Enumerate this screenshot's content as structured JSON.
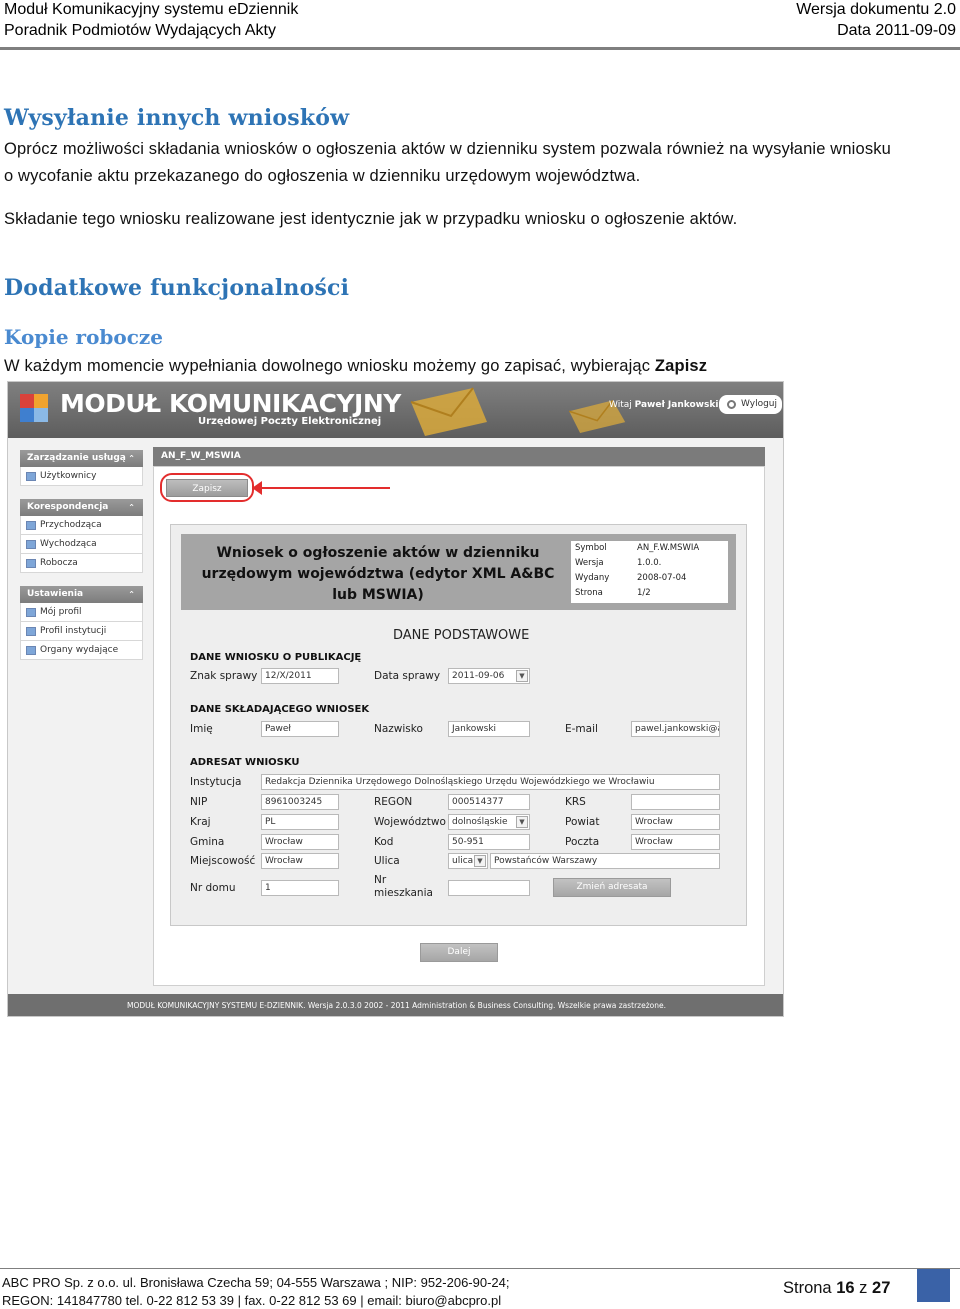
{
  "header": {
    "left_line1": "Moduł Komunikacyjny systemu eDziennik",
    "left_line2": "Poradnik Podmiotów Wydających Akty",
    "right_line1": "Wersja dokumentu 2.0",
    "right_line2": "Data 2011-09-09"
  },
  "section1": {
    "title": "Wysyłanie innych wniosków",
    "para1_line1": "Oprócz możliwości składania wniosków o ogłoszenia aktów w dzienniku system pozwala również na wysyłanie wniosku",
    "para1_line2": "o wycofanie aktu przekazanego do ogłoszenia w dzienniku urzędowym województwa.",
    "para2": "Składanie tego wniosku realizowane jest identycznie jak w przypadku wniosku o ogłoszenie aktów."
  },
  "section2": {
    "title": "Dodatkowe funkcjonalności",
    "subtitle": "Kopie robocze",
    "para_prefix": "W każdym momencie wypełniania dowolnego wniosku możemy go zapisać, wybierając ",
    "para_bold": "Zapisz"
  },
  "screenshot": {
    "brand": "MODUŁ KOMUNIKACYJNY",
    "brand_sub": "Urzędowej Poczty Elektronicznej",
    "welcome_prefix": "Witaj ",
    "welcome_user": "Paweł Jankowski",
    "logout": "Wyloguj",
    "sidebar": {
      "group1": "Zarządzanie usługą",
      "group1_items": [
        "Użytkownicy"
      ],
      "group2": "Korespondencja",
      "group2_items": [
        "Przychodząca",
        "Wychodząca",
        "Robocza"
      ],
      "group3": "Ustawienia",
      "group3_items": [
        "Mój profil",
        "Profil instytucji",
        "Organy wydające"
      ]
    },
    "main_title": "AN_F_W_MSWIA",
    "save_button": "Zapisz",
    "form_title": "Wniosek o ogłoszenie aktów w dzienniku urzędowym województwa (edytor XML A&BC lub MSWIA)",
    "meta": {
      "symbol_label": "Symbol",
      "symbol_value": "AN_F.W.MSWIA",
      "version_label": "Wersja",
      "version_value": "1.0.0.",
      "issued_label": "Wydany",
      "issued_value": "2008-07-04",
      "page_label": "Strona",
      "page_value": "1/2"
    },
    "section_title": "DANE PODSTAWOWE",
    "pub": {
      "group": "DANE WNIOSKU O PUBLIKACJĘ",
      "case_label": "Znak sprawy",
      "case_value": "12/X/2011",
      "date_label": "Data sprawy",
      "date_value": "2011-09-06"
    },
    "applicant": {
      "group": "DANE SKŁADAJĄCEGO WNIOSEK",
      "first_label": "Imię",
      "first_value": "Paweł",
      "last_label": "Nazwisko",
      "last_value": "Jankowski",
      "email_label": "E-mail",
      "email_value": "pawel.jankowski@a"
    },
    "addressee": {
      "group": "ADRESAT WNIOSKU",
      "inst_label": "Instytucja",
      "inst_value": "Redakcja Dziennika Urzędowego Dolnośląskiego Urzędu Wojewódzkiego we Wrocławiu",
      "nip_label": "NIP",
      "nip_value": "8961003245",
      "regon_label": "REGON",
      "regon_value": "000514377",
      "krs_label": "KRS",
      "krs_value": "",
      "country_label": "Kraj",
      "country_value": "PL",
      "voiv_label": "Województwo",
      "voiv_value": "dolnośląskie",
      "county_label": "Powiat",
      "county_value": "Wrocław",
      "commune_label": "Gmina",
      "commune_value": "Wrocław",
      "zip_label": "Kod",
      "zip_value": "50-951",
      "post_label": "Poczta",
      "post_value": "Wrocław",
      "city_label": "Miejscowość",
      "city_value": "Wrocław",
      "street_label": "Ulica",
      "street_type": "ulica",
      "street_value": "Powstańców Warszawy",
      "house_label": "Nr domu",
      "house_value": "1",
      "flat_label_1": "Nr",
      "flat_label_2": "mieszkania",
      "flat_value": "",
      "change_button": "Zmień adresata"
    },
    "next_button": "Dalej",
    "footer": "MODUŁ KOMUNIKACYJNY SYSTEMU E-DZIENNIK. Wersja 2.0.3.0 2002 - 2011 Administration & Business Consulting. Wszelkie prawa zastrzeżone."
  },
  "footer": {
    "line1": "ABC PRO Sp. z o.o. ul. Bronisława Czecha 59;  04-555 Warszawa ; NIP: 952-206-90-24;",
    "line2": "REGON: 141847780 tel. 0-22 812 53 39 | fax. 0-22 812 53 69 | email: biuro@abcpro.pl",
    "page_word": "Strona",
    "page_num": "16",
    "page_of": "z",
    "page_total": "27"
  },
  "colors": {
    "heading": "#2e74b5",
    "subheading": "#4a8ad0",
    "highlight": "#e32d2d",
    "footer_block": "#3a62a7"
  }
}
